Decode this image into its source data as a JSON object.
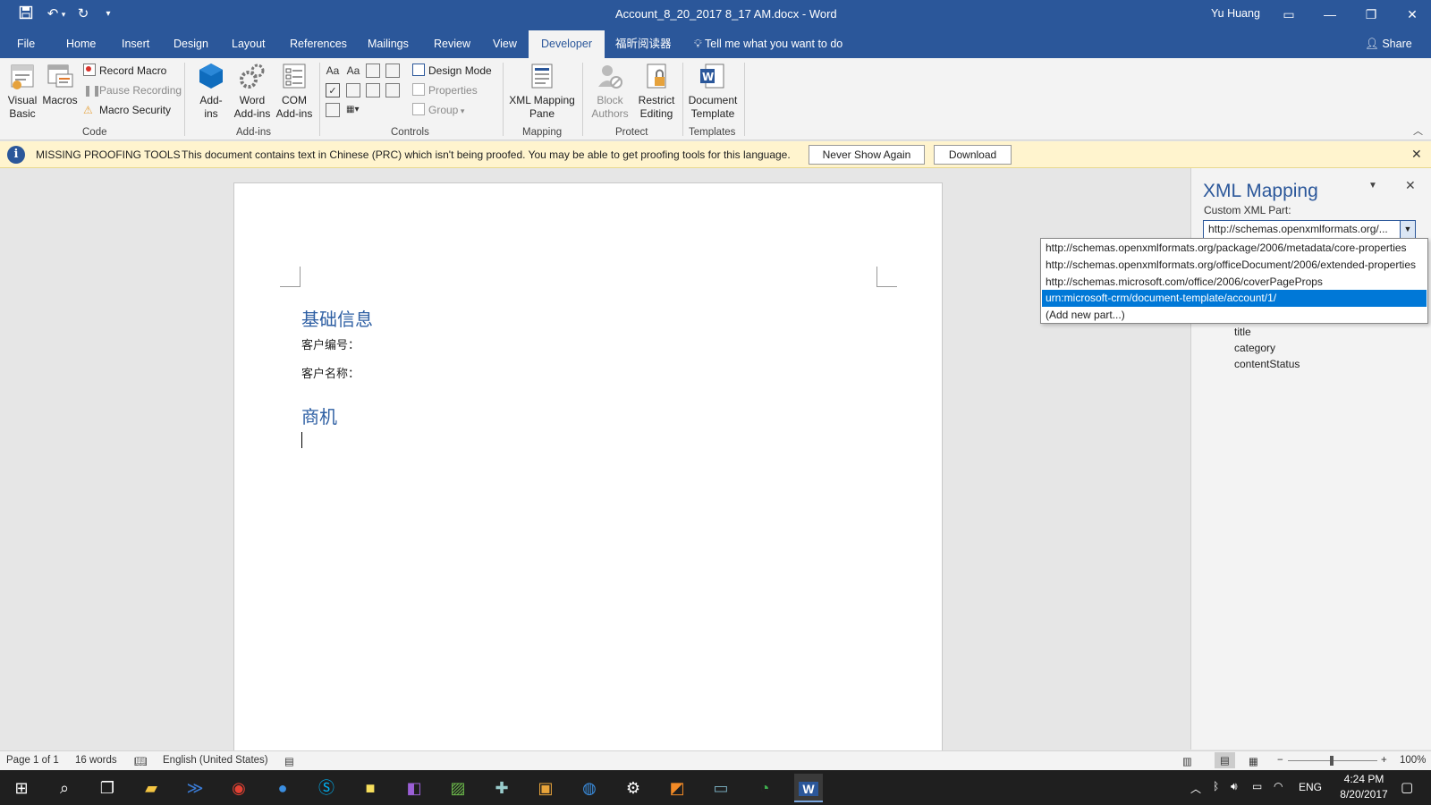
{
  "window": {
    "title": "Account_8_20_2017 8_17 AM.docx  -  Word",
    "user": "Yu Huang"
  },
  "qat": {
    "save_icon": "save-icon",
    "undo_icon": "undo-icon",
    "redo_icon": "redo-icon",
    "customize_icon": "customize-icon"
  },
  "tabs": [
    {
      "label": "File"
    },
    {
      "label": "Home"
    },
    {
      "label": "Insert"
    },
    {
      "label": "Design"
    },
    {
      "label": "Layout"
    },
    {
      "label": "References"
    },
    {
      "label": "Mailings"
    },
    {
      "label": "Review"
    },
    {
      "label": "View"
    },
    {
      "label": "Developer"
    },
    {
      "label": "福昕阅读器"
    }
  ],
  "tell_me": "Tell me what you want to do",
  "share": "Share",
  "ribbon": {
    "code": {
      "label": "Code",
      "visual_basic": "Visual\nBasic",
      "macros": "Macros",
      "record_macro": "Record Macro",
      "pause_recording": "Pause Recording",
      "macro_security": "Macro Security"
    },
    "addins": {
      "label": "Add-ins",
      "addins": "Add-\nins",
      "word_addins": "Word\nAdd-ins",
      "com_addins": "COM\nAdd-ins"
    },
    "controls": {
      "label": "Controls",
      "design_mode": "Design Mode",
      "properties": "Properties",
      "group": "Group"
    },
    "mapping": {
      "label": "Mapping",
      "xml_mapping_pane": "XML Mapping\nPane"
    },
    "protect": {
      "label": "Protect",
      "block_authors": "Block\nAuthors",
      "restrict_editing": "Restrict\nEditing"
    },
    "templates": {
      "label": "Templates",
      "document_template": "Document\nTemplate"
    }
  },
  "message_bar": {
    "title": "MISSING PROOFING TOOLS",
    "text": "This document contains text in Chinese (PRC) which isn't being proofed. You may be able to get proofing tools for this language.",
    "never_show": "Never Show Again",
    "download": "Download"
  },
  "document": {
    "heading1": "基础信息",
    "line1": "客户编号：",
    "line2": "客户名称：",
    "heading2": "商机"
  },
  "xml_pane": {
    "title": "XML Mapping",
    "custom_part_label": "Custom XML Part:",
    "selected": "http://schemas.openxmlformats.org/...",
    "options": [
      "http://schemas.openxmlformats.org/package/2006/metadata/core-properties",
      "http://schemas.openxmlformats.org/officeDocument/2006/extended-properties",
      "http://schemas.microsoft.com/office/2006/coverPageProps",
      "urn:microsoft-crm/document-template/account/1/",
      "(Add new part...)"
    ],
    "nodes": [
      "title",
      "category",
      "contentStatus"
    ]
  },
  "status": {
    "page": "Page 1 of 1",
    "words": "16 words",
    "language": "English (United States)",
    "zoom": "100%"
  },
  "tray": {
    "lang": "ENG",
    "time": "4:24 PM",
    "date": "8/20/2017"
  }
}
